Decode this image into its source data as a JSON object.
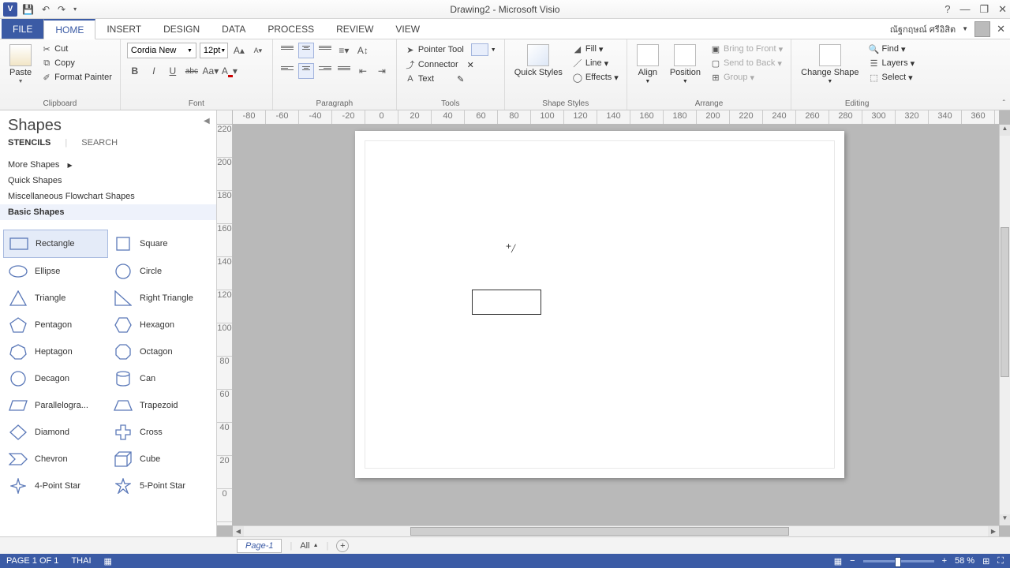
{
  "title": "Drawing2 - Microsoft Visio",
  "tabs": {
    "file": "FILE",
    "home": "HOME",
    "insert": "INSERT",
    "design": "DESIGN",
    "data": "DATA",
    "process": "PROCESS",
    "review": "REVIEW",
    "view": "VIEW"
  },
  "user": "ณัฐกฤษณ์ ศรีอิสิต",
  "ribbon": {
    "clipboard": {
      "paste": "Paste",
      "cut": "Cut",
      "copy": "Copy",
      "format_painter": "Format Painter",
      "label": "Clipboard"
    },
    "font": {
      "name": "Cordia New",
      "size": "12pt",
      "label": "Font"
    },
    "paragraph": {
      "label": "Paragraph"
    },
    "tools": {
      "pointer": "Pointer Tool",
      "connector": "Connector",
      "text": "Text",
      "label": "Tools"
    },
    "shape_styles": {
      "quick": "Quick Styles",
      "fill": "Fill",
      "line": "Line",
      "effects": "Effects",
      "label": "Shape Styles"
    },
    "arrange": {
      "align": "Align",
      "position": "Position",
      "bring_front": "Bring to Front",
      "send_back": "Send to Back",
      "group": "Group",
      "label": "Arrange"
    },
    "editing": {
      "change_shape": "Change Shape",
      "find": "Find",
      "layers": "Layers",
      "select": "Select",
      "label": "Editing"
    }
  },
  "shapes": {
    "title": "Shapes",
    "tabs": {
      "stencils": "STENCILS",
      "search": "SEARCH"
    },
    "more": "More Shapes",
    "quick": "Quick Shapes",
    "misc": "Miscellaneous Flowchart Shapes",
    "basic": "Basic Shapes",
    "items": [
      {
        "label": "Rectangle"
      },
      {
        "label": "Square"
      },
      {
        "label": "Ellipse"
      },
      {
        "label": "Circle"
      },
      {
        "label": "Triangle"
      },
      {
        "label": "Right Triangle"
      },
      {
        "label": "Pentagon"
      },
      {
        "label": "Hexagon"
      },
      {
        "label": "Heptagon"
      },
      {
        "label": "Octagon"
      },
      {
        "label": "Decagon"
      },
      {
        "label": "Can"
      },
      {
        "label": "Parallelogra..."
      },
      {
        "label": "Trapezoid"
      },
      {
        "label": "Diamond"
      },
      {
        "label": "Cross"
      },
      {
        "label": "Chevron"
      },
      {
        "label": "Cube"
      },
      {
        "label": "4-Point Star"
      },
      {
        "label": "5-Point Star"
      }
    ]
  },
  "ruler_h": [
    "-80",
    "-60",
    "-40",
    "-20",
    "0",
    "20",
    "40",
    "60",
    "80",
    "100",
    "120",
    "140",
    "160",
    "180",
    "200",
    "220",
    "240",
    "260",
    "280",
    "300",
    "320",
    "340",
    "360"
  ],
  "ruler_v": [
    "220",
    "200",
    "180",
    "160",
    "140",
    "120",
    "100",
    "80",
    "60",
    "40",
    "20",
    "0"
  ],
  "page_tab": "Page-1",
  "all": "All",
  "status": {
    "page": "PAGE 1 OF 1",
    "lang": "THAI",
    "zoom": "58 %"
  }
}
